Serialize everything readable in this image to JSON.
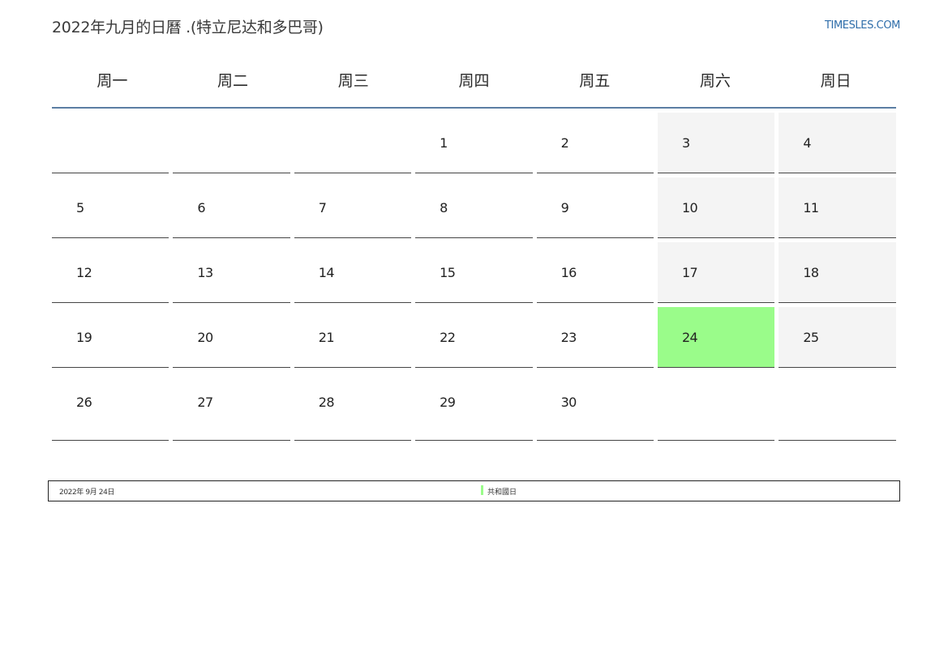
{
  "header": {
    "title": "2022年九月的日曆 .(特立尼达和多巴哥)",
    "site": "TIMESLES.COM"
  },
  "weekdays": [
    "周一",
    "周二",
    "周三",
    "周四",
    "周五",
    "周六",
    "周日"
  ],
  "weeks": [
    [
      "",
      "",
      "",
      "1",
      "2",
      "3",
      "4"
    ],
    [
      "5",
      "6",
      "7",
      "8",
      "9",
      "10",
      "11"
    ],
    [
      "12",
      "13",
      "14",
      "15",
      "16",
      "17",
      "18"
    ],
    [
      "19",
      "20",
      "21",
      "22",
      "23",
      "24",
      "25"
    ],
    [
      "26",
      "27",
      "28",
      "29",
      "30",
      "",
      ""
    ]
  ],
  "holiday_day": "24",
  "colors": {
    "holiday": "#9afc8a",
    "weekend": "#f4f4f4",
    "header_rule": "#5b7ea3",
    "link": "#2f6eaa"
  },
  "legend": {
    "date": "2022年 9月 24日",
    "holiday_name": "共和國日"
  }
}
